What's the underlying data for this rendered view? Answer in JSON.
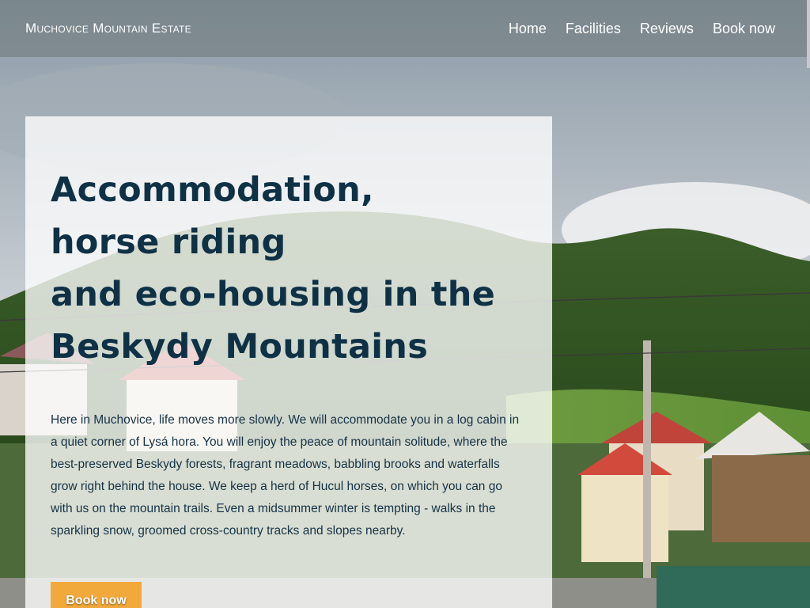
{
  "brand": {
    "name": "Muchovice Mountain Estate"
  },
  "nav": {
    "items": [
      {
        "label": "Home"
      },
      {
        "label": "Facilities"
      },
      {
        "label": "Reviews"
      },
      {
        "label": "Book now"
      }
    ]
  },
  "hero": {
    "title_lines": [
      "Accommodation,",
      "horse riding",
      "and eco-housing in the",
      "Beskydy Mountains"
    ],
    "text": "Here in Muchovice, life moves more slowly. We will accommodate you in a log cabin in a quiet corner of Lysá hora. You will enjoy the peace of mountain solitude, where the best-preserved Beskydy forests, fragrant meadows, babbling brooks and waterfalls grow right behind the house. We keep a herd of Hucul horses, on which you can go with us on the mountain trails. Even a midsummer winter is tempting - walks in the sparkling snow, groomed cross-country tracks and slopes nearby.",
    "button_label": "Book now"
  },
  "colors": {
    "title": "#0f3145",
    "button": "#f2a93b",
    "navbar_overlay": "#6e787a"
  }
}
